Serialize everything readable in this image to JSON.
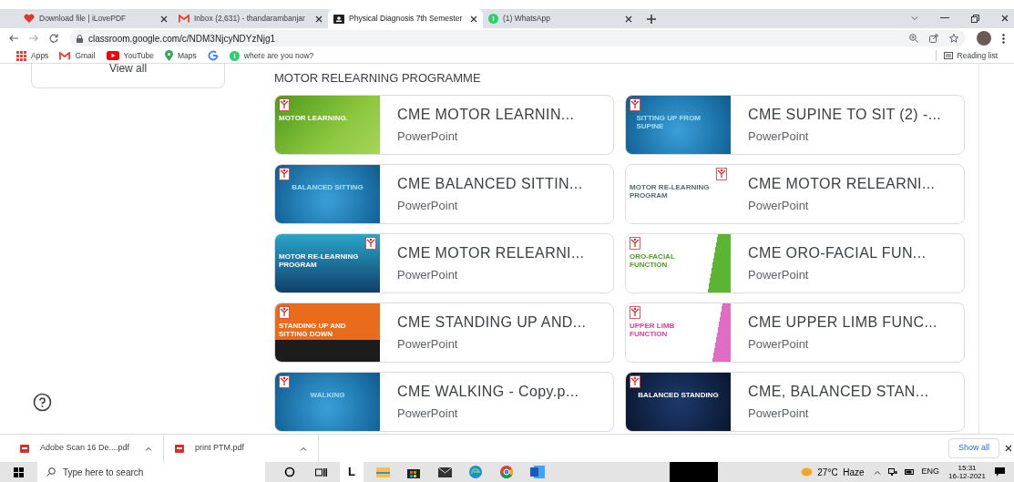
{
  "tabs": [
    {
      "title": "Download file | iLovePDF",
      "selected": false
    },
    {
      "title": "Inbox (2,631) - thandarambanjar",
      "selected": false
    },
    {
      "title": "Physical Diagnosis 7th Semester",
      "selected": true
    },
    {
      "title": "(1) WhatsApp",
      "selected": false
    }
  ],
  "address": {
    "url": "classroom.google.com/c/NDM3NjcyNDYzNjg1"
  },
  "bookmarks": [
    {
      "kind": "labeled",
      "label": "Apps"
    },
    {
      "kind": "labeled",
      "label": "Gmail"
    },
    {
      "kind": "labeled",
      "label": "YouTube"
    },
    {
      "kind": "labeled",
      "label": "Maps"
    },
    {
      "kind": "icon-only"
    },
    {
      "kind": "labeled",
      "label": "where are you now?"
    }
  ],
  "reading_list": "Reading list",
  "sidebar": {
    "view_all": "View all"
  },
  "section_title": "MOTOR RELEARNING PROGRAMME",
  "materials": [
    {
      "title": "CME MOTOR LEARNIN...",
      "type": "PowerPoint",
      "thumb": {
        "kind": "green",
        "text": "MOTOR LEARNING."
      }
    },
    {
      "title": "CME SUPINE TO SIT (2) -...",
      "type": "PowerPoint",
      "thumb": {
        "kind": "blue",
        "text": "SITTING UP FROM SUPINE"
      }
    },
    {
      "title": "CME BALANCED SITTIN...",
      "type": "PowerPoint",
      "thumb": {
        "kind": "blue",
        "text": "BALANCED SITTING"
      }
    },
    {
      "title": "CME MOTOR RELEARNI...",
      "type": "PowerPoint",
      "thumb": {
        "kind": "white",
        "text": "MOTOR RE-LEARNING PROGRAM"
      }
    },
    {
      "title": "CME MOTOR RELEARNI...",
      "type": "PowerPoint",
      "thumb": {
        "kind": "teal",
        "text": "MOTOR RE-LEARNING PROGRAM"
      }
    },
    {
      "title": "CME ORO-FACIAL FUN...",
      "type": "PowerPoint",
      "thumb": {
        "kind": "white-green",
        "text": "ORO-FACIAL FUNCTION"
      }
    },
    {
      "title": "CME STANDING UP AND...",
      "type": "PowerPoint",
      "thumb": {
        "kind": "orange",
        "text": "STANDING UP AND SITTING DOWN"
      }
    },
    {
      "title": "CME UPPER LIMB FUNC...",
      "type": "PowerPoint",
      "thumb": {
        "kind": "white-pink",
        "text": "UPPER LIMB FUNCTION"
      }
    },
    {
      "title": "CME WALKING - Copy.p...",
      "type": "PowerPoint",
      "thumb": {
        "kind": "blue",
        "text": "WALKING"
      }
    },
    {
      "title": "CME, BALANCED STAN...",
      "type": "PowerPoint",
      "thumb": {
        "kind": "navy",
        "text": "BALANCED STANDING"
      }
    }
  ],
  "downloads": [
    {
      "name": "Adobe Scan 16 De....pdf"
    },
    {
      "name": "print PTM.pdf"
    }
  ],
  "show_all": "Show all",
  "taskbar": {
    "search_placeholder": "Type here to search",
    "pinned_letter": "L",
    "weather": "27°C  Haze",
    "language": "ENG",
    "time": "15:31",
    "date": "16-12-2021"
  }
}
